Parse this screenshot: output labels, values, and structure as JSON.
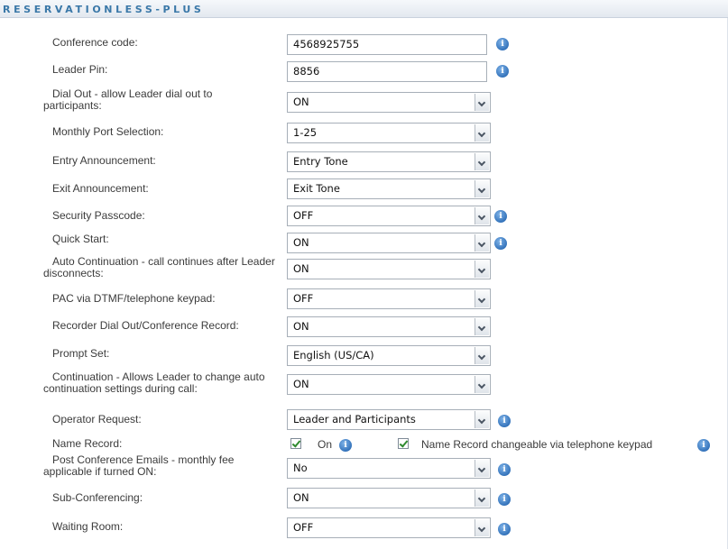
{
  "header": {
    "title": "RESERVATIONLESS-PLUS"
  },
  "fields": {
    "conference_code": {
      "label": "Conference code:",
      "value": "4568925755",
      "info_icon": "info-icon"
    },
    "leader_pin": {
      "label": "Leader Pin:",
      "value": "8856",
      "info_icon": "info-icon"
    },
    "dial_out": {
      "label": "Dial Out - allow Leader dial out to participants:",
      "value": "ON"
    },
    "monthly_port": {
      "label": "Monthly Port Selection:",
      "value": "1-25"
    },
    "entry_announcement": {
      "label": "Entry Announcement:",
      "value": "Entry Tone"
    },
    "exit_announcement": {
      "label": "Exit Announcement:",
      "value": "Exit Tone"
    },
    "security_passcode": {
      "label": "Security Passcode:",
      "value": "OFF",
      "info_icon": "info-icon"
    },
    "quick_start": {
      "label": "Quick Start:",
      "value": "ON",
      "info_icon": "info-icon"
    },
    "auto_continuation": {
      "label": "Auto Continuation - call continues after Leader disconnects:",
      "value": "ON"
    },
    "pac_dtmf": {
      "label": "PAC via DTMF/telephone keypad:",
      "value": "OFF"
    },
    "recorder_dial_out": {
      "label": "Recorder Dial Out/Conference Record:",
      "value": "ON"
    },
    "prompt_set": {
      "label": "Prompt Set:",
      "value": "English (US/CA)"
    },
    "continuation": {
      "label": "Continuation - Allows Leader to change auto continuation settings during call:",
      "value": "ON"
    },
    "operator_request": {
      "label": "Operator Request:",
      "value": "Leader and Participants",
      "info_icon": "info-icon"
    },
    "name_record": {
      "label": "Name Record:",
      "checkbox_on_label": "On",
      "checkbox_on_checked": true,
      "checkbox_keypad_label": "Name Record changeable via telephone keypad",
      "checkbox_keypad_checked": true
    },
    "post_conference_emails": {
      "label": "Post Conference Emails - monthly fee applicable if turned ON:",
      "value": "No",
      "info_icon": "info-icon"
    },
    "sub_conferencing": {
      "label": "Sub-Conferencing:",
      "value": "ON",
      "info_icon": "info-icon"
    },
    "waiting_room": {
      "label": "Waiting Room:",
      "value": "OFF",
      "info_icon": "info-icon"
    }
  },
  "icons": {
    "info": "i"
  },
  "colors": {
    "header_text": "#3a78a8",
    "info_icon": "#2f6fb8",
    "check": "#2f8a2f"
  }
}
